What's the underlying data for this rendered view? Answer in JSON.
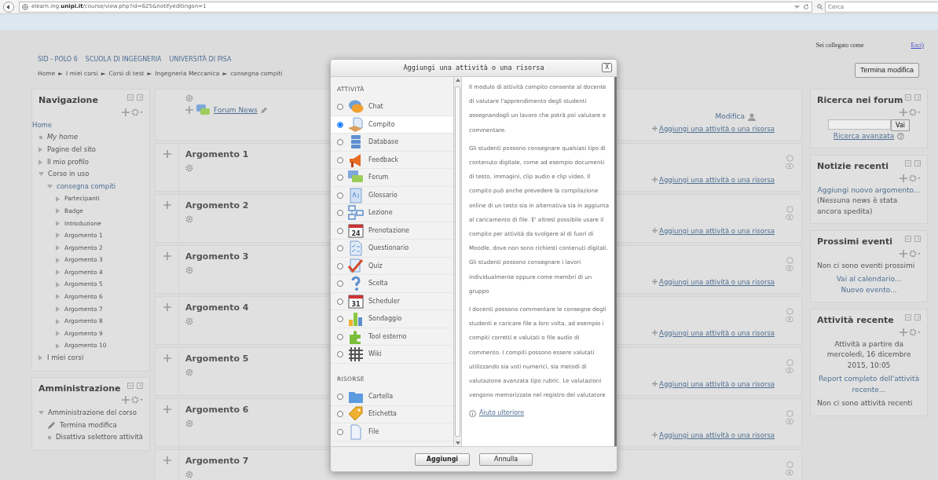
{
  "browser": {
    "url": "elearn.ing.**unipi.it**/course/view.php?id=625&notifyeditingon=1",
    "search_placeholder": "Cerca"
  },
  "login": {
    "text": "Sei collegato come",
    "logout": "Esci)"
  },
  "header": {
    "links": [
      "SID - POLO 6",
      "SCUOLA DI INGEGNERIA",
      "UNIVERSITÀ DI PISA"
    ],
    "separator": "►",
    "breadcrumb": [
      "Home",
      "I miei corsi",
      "Corsi di test",
      "Ingegneria Meccanica",
      "consegna compiti"
    ],
    "edit_button": "Termina modifica"
  },
  "navigation": {
    "title": "Navigazione",
    "items": [
      {
        "label": "Home",
        "kind": "home"
      },
      {
        "label": "My home",
        "kind": "bullet"
      },
      {
        "label": "Pagine del sito",
        "kind": "branch",
        "expanded": false
      },
      {
        "label": "Il mio profilo",
        "kind": "branch",
        "expanded": false
      },
      {
        "label": "Corso in uso",
        "kind": "branch",
        "expanded": true,
        "children": [
          {
            "label": "consegna compiti",
            "kind": "branch",
            "expanded": true,
            "children": [
              {
                "label": "Partecipanti",
                "kind": "branch",
                "expanded": false
              },
              {
                "label": "Badge",
                "kind": "branch",
                "expanded": false
              },
              {
                "label": "Introduzione",
                "kind": "branch",
                "expanded": false
              },
              {
                "label": "Argomento 1",
                "kind": "branch",
                "expanded": false
              },
              {
                "label": "Argomento 2",
                "kind": "branch",
                "expanded": false
              },
              {
                "label": "Argomento 3",
                "kind": "branch",
                "expanded": false
              },
              {
                "label": "Argomento 4",
                "kind": "branch",
                "expanded": false
              },
              {
                "label": "Argomento 5",
                "kind": "branch",
                "expanded": false
              },
              {
                "label": "Argomento 6",
                "kind": "branch",
                "expanded": false
              },
              {
                "label": "Argomento 7",
                "kind": "branch",
                "expanded": false
              },
              {
                "label": "Argomento 8",
                "kind": "branch",
                "expanded": false
              },
              {
                "label": "Argomento 9",
                "kind": "branch",
                "expanded": false
              },
              {
                "label": "Argomento 10",
                "kind": "branch",
                "expanded": false
              }
            ]
          }
        ]
      },
      {
        "label": "I miei corsi",
        "kind": "branch",
        "expanded": false
      }
    ]
  },
  "administration": {
    "title": "Amministrazione",
    "items": [
      {
        "label": "Amministrazione del corso",
        "kind": "branch",
        "expanded": true,
        "children": [
          {
            "label": "Termina modifica",
            "kind": "pencil"
          },
          {
            "label": "Disattiva selettore attività",
            "kind": "bullet"
          }
        ]
      }
    ]
  },
  "sections": [
    {
      "kind": "general",
      "activity": "Forum News",
      "edit_menu": "Modifica",
      "add_link": "Aggiungi una attività o una risorsa"
    },
    {
      "kind": "topic",
      "title": "Argomento 1",
      "add_link": "Aggiungi una attività o una risorsa"
    },
    {
      "kind": "topic",
      "title": "Argomento 2",
      "add_link": "Aggiungi una attività o una risorsa"
    },
    {
      "kind": "topic",
      "title": "Argomento 3",
      "add_link": "Aggiungi una attività o una risorsa"
    },
    {
      "kind": "topic",
      "title": "Argomento 4",
      "add_link": "Aggiungi una attività o una risorsa"
    },
    {
      "kind": "topic",
      "title": "Argomento 5",
      "add_link": "Aggiungi una attività o una risorsa"
    },
    {
      "kind": "topic",
      "title": "Argomento 6",
      "add_link": "Aggiungi una attività o una risorsa"
    },
    {
      "kind": "topic",
      "title": "Argomento 7"
    }
  ],
  "forum_search": {
    "title": "Ricerca nei forum",
    "button": "Vai",
    "advanced": "Ricerca avanzata"
  },
  "news": {
    "title": "Notizie recenti",
    "add_link": "Aggiungi nuovo argomento...",
    "note": "(Nessuna news è stata ancora spedita)"
  },
  "events": {
    "title": "Prossimi eventi",
    "note": "Non ci sono eventi prossimi",
    "links": [
      "Vai al calendario...",
      "Nuovo evento..."
    ]
  },
  "recent": {
    "title": "Attività recente",
    "since": "Attività a partire da mercoledì, 16 dicembre 2015, 10:05",
    "report_link": "Report completo dell'attività recente...",
    "note": "Non ci sono attività recenti"
  },
  "modal": {
    "title": "Aggiungi una attività o una risorsa",
    "close": "X",
    "groups": [
      {
        "heading": "ATTIVITÀ",
        "items": [
          {
            "label": "Chat",
            "kind": "chat",
            "selected": false
          },
          {
            "label": "Compito",
            "kind": "assignment",
            "selected": true
          },
          {
            "label": "Database",
            "kind": "database",
            "selected": false
          },
          {
            "label": "Feedback",
            "kind": "feedback",
            "selected": false
          },
          {
            "label": "Forum",
            "kind": "forum",
            "selected": false
          },
          {
            "label": "Glossario",
            "kind": "glossary",
            "selected": false
          },
          {
            "label": "Lezione",
            "kind": "lesson",
            "selected": false
          },
          {
            "label": "Prenotazione",
            "kind": "calendar",
            "icon_text": "24",
            "selected": false
          },
          {
            "label": "Questionario",
            "kind": "questionnaire",
            "selected": false
          },
          {
            "label": "Quiz",
            "kind": "quiz",
            "selected": false
          },
          {
            "label": "Scelta",
            "kind": "choice",
            "selected": false
          },
          {
            "label": "Scheduler",
            "kind": "calendar",
            "icon_text": "31",
            "selected": false
          },
          {
            "label": "Sondaggio",
            "kind": "survey",
            "selected": false
          },
          {
            "label": "Tool esterno",
            "kind": "puzzle",
            "selected": false
          },
          {
            "label": "Wiki",
            "kind": "wiki",
            "selected": false
          }
        ]
      },
      {
        "heading": "RISORSE",
        "items": [
          {
            "label": "Cartella",
            "kind": "folder",
            "selected": false
          },
          {
            "label": "Etichetta",
            "kind": "tag",
            "selected": false
          },
          {
            "label": "File",
            "kind": "file",
            "selected": false
          }
        ]
      }
    ],
    "description": [
      "Il modulo di attività compito consente al docente di valutare l'apprendimento degli studenti assegnandogli un lavoro che potrà poi valutare e commentare.",
      "Gli studenti possono consegnare qualsiasi tipo di contenuto digitale, come ad esempio documenti di testo, immagini, clip audio e clip video. Il compito può anche prevedere la compilazione online di un testo sia in alternativa sia in aggiunta al caricamento di file. E' altresì possibile usare il compito per attività da svolgere al di fuori di Moodle, dove non sono richiesti contenuti digitali. Gli studenti possono consegnare i lavori individualmente oppure come membri di un gruppo",
      "I docenti possono commentare le consegne degli studenti e caricare file a loro volta, ad esempio i compiti corretti e valutati o file audio di commento. I compiti possono essere valutati utilizzando sia voti numerici, sia metodi di valutazione avanzata tipo rubric. Le valutazioni vengono memorizzate nel registro del valutatore"
    ],
    "help_link": "Aiuto ulteriore",
    "buttons": [
      "Aggiungi",
      "Annulla"
    ]
  }
}
